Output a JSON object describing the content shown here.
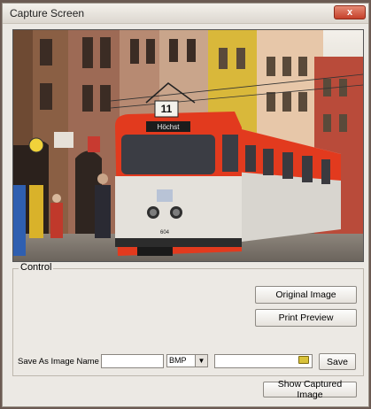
{
  "window": {
    "title": "Capture Screen",
    "close_label": "x"
  },
  "preview": {
    "tram_route": "11",
    "tram_destination": "Höchst",
    "tram_number": "604"
  },
  "control": {
    "group_label": "Control",
    "original_image_label": "Original Image",
    "print_preview_label": "Print Preview",
    "save_as_label": "Save As Image Name :",
    "filename_value": "",
    "format_selected": "BMP",
    "path_value": "",
    "save_label": "Save",
    "show_captured_label": "Show Captured Image"
  },
  "icons": {
    "folder": "folder-icon",
    "dropdown": "chevron-down-icon",
    "close": "close-icon"
  },
  "colors": {
    "tram_red": "#e23a1e",
    "close_button": "#c5402a"
  }
}
